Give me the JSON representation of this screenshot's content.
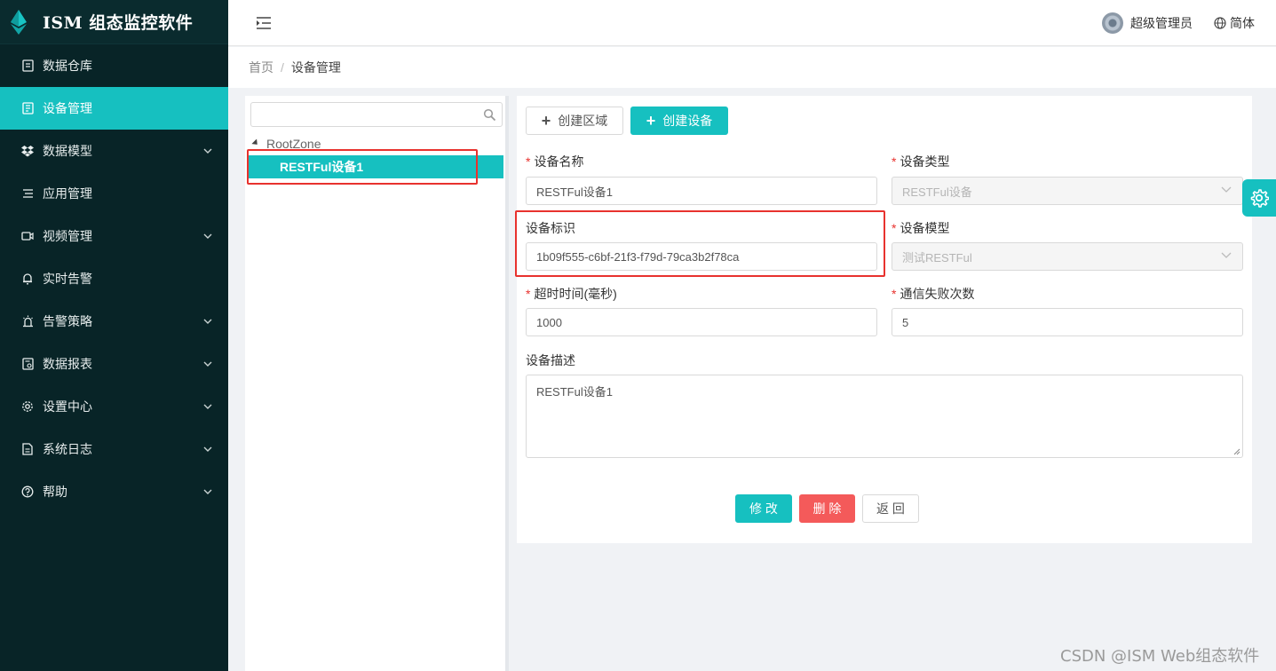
{
  "app": {
    "title": "ISM 组态监控软件"
  },
  "sidebar": {
    "items": [
      {
        "label": "数据仓库",
        "icon": "database-icon",
        "active": false,
        "expandable": false
      },
      {
        "label": "设备管理",
        "icon": "device-icon",
        "active": true,
        "expandable": false
      },
      {
        "label": "数据模型",
        "icon": "dropbox-icon",
        "active": false,
        "expandable": true
      },
      {
        "label": "应用管理",
        "icon": "list-icon",
        "active": false,
        "expandable": false
      },
      {
        "label": "视频管理",
        "icon": "video-icon",
        "active": false,
        "expandable": true
      },
      {
        "label": "实时告警",
        "icon": "bell-icon",
        "active": false,
        "expandable": false
      },
      {
        "label": "告警策略",
        "icon": "alarm-lamp-icon",
        "active": false,
        "expandable": true
      },
      {
        "label": "数据报表",
        "icon": "report-icon",
        "active": false,
        "expandable": true
      },
      {
        "label": "设置中心",
        "icon": "gear-icon",
        "active": false,
        "expandable": true
      },
      {
        "label": "系统日志",
        "icon": "log-file-icon",
        "active": false,
        "expandable": true
      },
      {
        "label": "帮助",
        "icon": "help-icon",
        "active": false,
        "expandable": true
      }
    ]
  },
  "header": {
    "user_name": "超级管理员",
    "language": "简体"
  },
  "breadcrumb": {
    "home": "首页",
    "separator": "/",
    "current": "设备管理"
  },
  "tree": {
    "search_placeholder": "",
    "root_label": "RootZone",
    "selected_node": "RESTFul设备1"
  },
  "toolbar": {
    "create_zone_label": "创建区域",
    "create_device_label": "创建设备"
  },
  "form": {
    "device_name": {
      "label": "设备名称",
      "value": "RESTFul设备1",
      "required": true
    },
    "device_type": {
      "label": "设备类型",
      "value": "RESTFul设备",
      "required": true,
      "disabled": true
    },
    "device_id": {
      "label": "设备标识",
      "value": "1b09f555-c6bf-21f3-f79d-79ca3b2f78ca",
      "required": false
    },
    "device_model": {
      "label": "设备模型",
      "value": "测试RESTFul",
      "required": true,
      "disabled": true
    },
    "timeout": {
      "label": "超时时间(毫秒)",
      "value": "1000",
      "required": true
    },
    "fail_count": {
      "label": "通信失败次数",
      "value": "5",
      "required": true
    },
    "description": {
      "label": "设备描述",
      "value": "RESTFul设备1",
      "required": false
    }
  },
  "actions": {
    "modify_label": "修 改",
    "delete_label": "删 除",
    "back_label": "返 回"
  },
  "watermark": "CSDN @ISM Web组态软件",
  "colors": {
    "sidebar_bg": "#082427",
    "accent": "#16c0c0",
    "danger": "#f45a5a",
    "highlight_box": "#e8322e"
  }
}
